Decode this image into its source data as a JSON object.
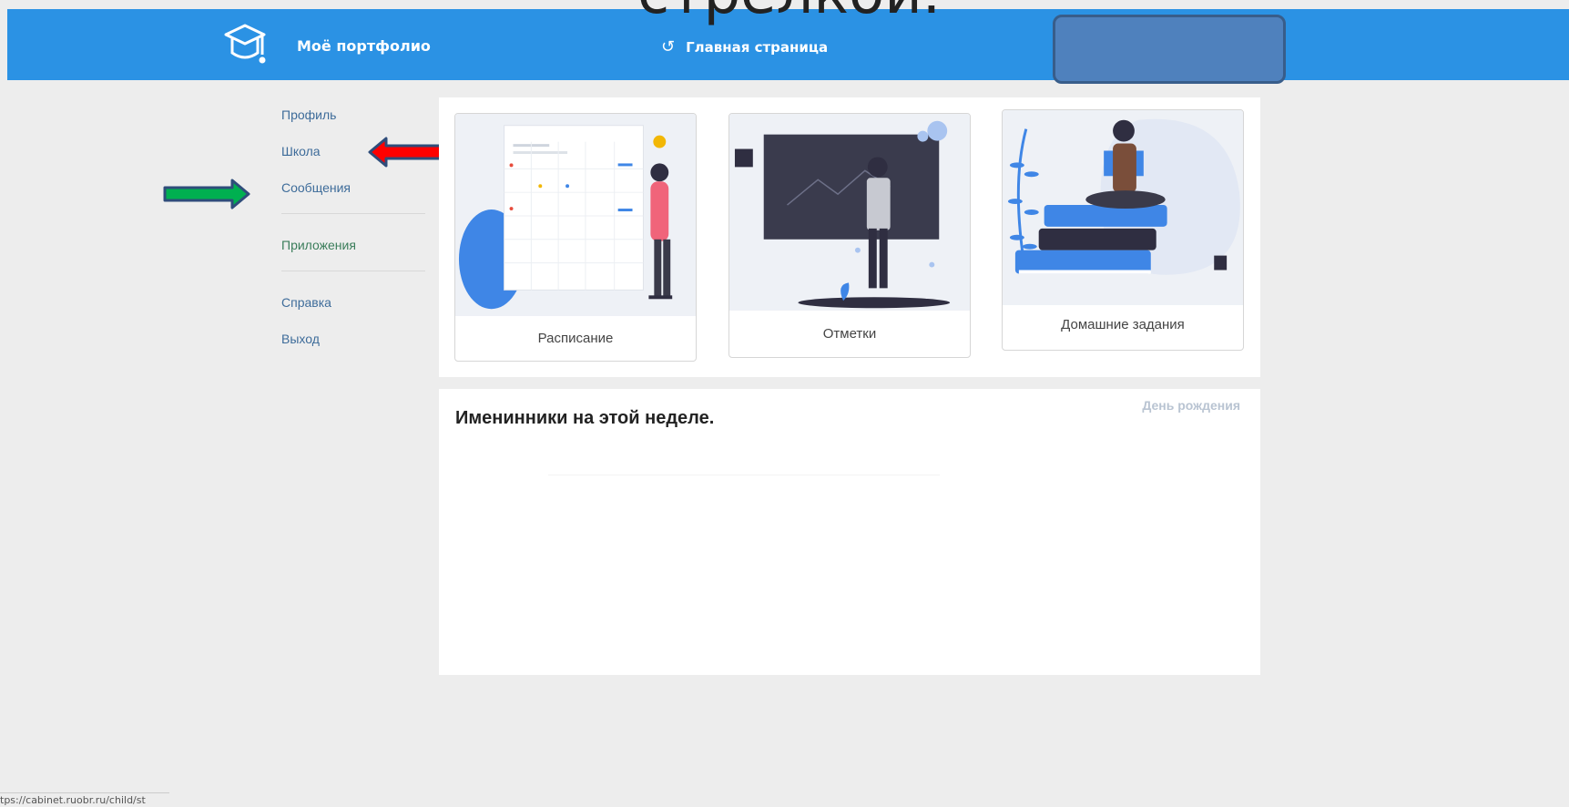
{
  "slide": {
    "overlay_text": "стрелкой."
  },
  "header": {
    "brand": "Моё портфолио",
    "home_link": "Главная страница",
    "refresh_icon": "↺"
  },
  "sidebar": {
    "items": [
      {
        "label": "Профиль"
      },
      {
        "label": "Школа"
      },
      {
        "label": "Сообщения"
      },
      {
        "label": "Приложения"
      },
      {
        "label": "Справка"
      },
      {
        "label": "Выход"
      }
    ]
  },
  "cards": [
    {
      "label": "Расписание",
      "icon": "schedule-illustration"
    },
    {
      "label": "Отметки",
      "icon": "grades-illustration"
    },
    {
      "label": "Домашние задания",
      "icon": "homework-illustration"
    }
  ],
  "birthdays": {
    "title": "Именинники на этой неделе.",
    "tag": "День рождения"
  },
  "status_bar": {
    "url": "tps://cabinet.ruobr.ru/child/st"
  },
  "colors": {
    "header": "#2b92e4",
    "redaction": "#4f81bd",
    "red_arrow": "#ff0000",
    "green_arrow": "#00b050"
  }
}
